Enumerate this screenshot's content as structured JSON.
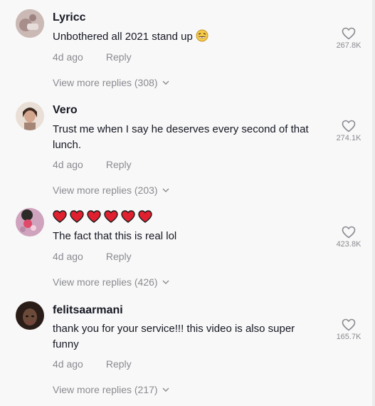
{
  "comments": [
    {
      "username": "Lyricc",
      "text": "Unbothered all 2021 stand up",
      "text_emoji": "laughing-face",
      "time": "4d ago",
      "reply_label": "Reply",
      "likes": "267.8K",
      "view_more": "View more replies (308)",
      "avatar_color": "#c9b8b4"
    },
    {
      "username": "Vero",
      "text": "Trust me when I say he deserves every second of that lunch.",
      "time": "4d ago",
      "reply_label": "Reply",
      "likes": "274.1K",
      "view_more": "View more replies (203)",
      "avatar_color": "#d6b9a7"
    },
    {
      "username_emoji": "red-heart x6",
      "text": "The fact that this is real lol",
      "time": "4d ago",
      "reply_label": "Reply",
      "likes": "423.8K",
      "view_more": "View more replies (426)",
      "avatar_color": "#c7a2b6"
    },
    {
      "username": "felitsaarmani",
      "text": "thank you for your service!!! this video is also super funny",
      "time": "4d ago",
      "reply_label": "Reply",
      "likes": "165.7K",
      "view_more": "View more replies (217)",
      "avatar_color": "#3b2a22"
    }
  ],
  "colors": {
    "background": "#f8f8f8",
    "primary_text": "#161823",
    "secondary_text": "#8a8b91",
    "heart_emoji": "#e0202f"
  }
}
